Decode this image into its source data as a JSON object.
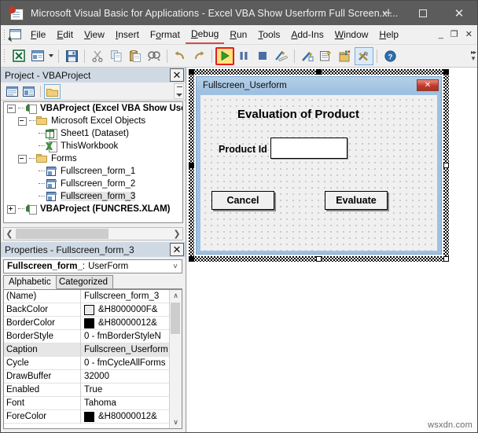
{
  "window": {
    "title": "Microsoft Visual Basic for Applications - Excel VBA Show Userform Full Screen.xl...",
    "icon": "vba-document-icon",
    "minimize_label": "–",
    "maximize_label": "□",
    "close_label": "✕"
  },
  "menubar": {
    "control_icon": "vba-control-icon",
    "items": [
      {
        "label": "File",
        "accel": "F",
        "active": false
      },
      {
        "label": "Edit",
        "accel": "E",
        "active": false
      },
      {
        "label": "View",
        "accel": "V",
        "active": false
      },
      {
        "label": "Insert",
        "accel": "I",
        "active": false
      },
      {
        "label": "Format",
        "accel": "o",
        "active": false
      },
      {
        "label": "Debug",
        "accel": "D",
        "active": true
      },
      {
        "label": "Run",
        "accel": "R",
        "active": false
      },
      {
        "label": "Tools",
        "accel": "T",
        "active": false
      },
      {
        "label": "Add-Ins",
        "accel": "A",
        "active": false
      },
      {
        "label": "Window",
        "accel": "W",
        "active": false
      },
      {
        "label": "Help",
        "accel": "H",
        "active": false
      }
    ],
    "doc_controls": {
      "minimize": "_",
      "restore": "❐",
      "close": "✕"
    }
  },
  "toolbar": {
    "buttons": [
      {
        "name": "view-excel-icon",
        "title": "View Microsoft Excel",
        "state": "normal"
      },
      {
        "name": "insert-userform-icon",
        "title": "Insert UserForm",
        "state": "normal"
      },
      {
        "name": "insert-dropdown-caret-icon",
        "title": "Insert dropdown",
        "state": "caret"
      },
      {
        "name": "save-icon",
        "title": "Save",
        "state": "normal"
      },
      {
        "name": "cut-icon",
        "title": "Cut",
        "state": "normal"
      },
      {
        "name": "copy-icon",
        "title": "Copy",
        "state": "normal"
      },
      {
        "name": "paste-icon",
        "title": "Paste",
        "state": "normal"
      },
      {
        "name": "find-icon",
        "title": "Find",
        "state": "normal"
      },
      {
        "name": "undo-icon",
        "title": "Undo",
        "state": "normal"
      },
      {
        "name": "redo-icon",
        "title": "Redo",
        "state": "normal"
      },
      {
        "name": "run-sub-userform-icon",
        "title": "Run Sub/UserForm",
        "state": "highlighted"
      },
      {
        "name": "break-icon",
        "title": "Break",
        "state": "normal"
      },
      {
        "name": "reset-icon",
        "title": "Reset",
        "state": "normal"
      },
      {
        "name": "design-mode-icon",
        "title": "Design Mode",
        "state": "normal"
      },
      {
        "name": "project-explorer-icon",
        "title": "Project Explorer",
        "state": "normal"
      },
      {
        "name": "properties-window-icon",
        "title": "Properties Window",
        "state": "normal"
      },
      {
        "name": "object-browser-icon",
        "title": "Object Browser",
        "state": "normal"
      },
      {
        "name": "toolbox-icon",
        "title": "Toolbox",
        "state": "selected"
      },
      {
        "name": "help-icon",
        "title": "Help",
        "state": "normal"
      }
    ],
    "highlight_color": "#e02020",
    "overflow_icon": "toolbar-overflow-icon"
  },
  "project_explorer": {
    "title": "Project - VBAProject",
    "close_icon": "close-icon",
    "tools": [
      {
        "name": "view-code-icon",
        "title": "View Code"
      },
      {
        "name": "view-object-icon",
        "title": "View Object"
      },
      {
        "name": "toggle-folders-icon",
        "title": "Toggle Folders",
        "selected": true
      }
    ],
    "tree": [
      {
        "label": "VBAProject (Excel VBA Show Use",
        "indent": 0,
        "node": "minus",
        "icon": "project-icon",
        "bold": true,
        "selected": false
      },
      {
        "label": "Microsoft Excel Objects",
        "indent": 1,
        "node": "minus",
        "icon": "folder-icon",
        "bold": false,
        "selected": false
      },
      {
        "label": "Sheet1 (Dataset)",
        "indent": 2,
        "node": "none",
        "icon": "worksheet-icon",
        "bold": false,
        "selected": false
      },
      {
        "label": "ThisWorkbook",
        "indent": 2,
        "node": "none",
        "icon": "workbook-icon",
        "bold": false,
        "selected": false
      },
      {
        "label": "Forms",
        "indent": 1,
        "node": "minus",
        "icon": "folder-icon",
        "bold": false,
        "selected": false
      },
      {
        "label": "Fullscreen_form_1",
        "indent": 2,
        "node": "none",
        "icon": "userform-icon",
        "bold": false,
        "selected": false
      },
      {
        "label": "Fullscreen_form_2",
        "indent": 2,
        "node": "none",
        "icon": "userform-icon",
        "bold": false,
        "selected": false
      },
      {
        "label": "Fullscreen_form_3",
        "indent": 2,
        "node": "none",
        "icon": "userform-icon",
        "bold": false,
        "selected": true
      },
      {
        "label": "VBAProject (FUNCRES.XLAM)",
        "indent": 0,
        "node": "plus",
        "icon": "project-icon",
        "bold": true,
        "selected": false
      }
    ],
    "hscroll": {
      "left_icon": "❮",
      "right_icon": "❯"
    }
  },
  "properties": {
    "title": "Properties - Fullscreen_form_3",
    "close_icon": "close-icon",
    "object_name": "Fullscreen_form_",
    "object_type": "UserForm",
    "dropdown_icon": "chevron-down-icon",
    "tabs": [
      {
        "label": "Alphabetic",
        "selected": true
      },
      {
        "label": "Categorized",
        "selected": false
      }
    ],
    "rows": [
      {
        "key": "(Name)",
        "value": "Fullscreen_form_3",
        "swatch": null,
        "highlighted": false
      },
      {
        "key": "BackColor",
        "value": "&H8000000F&",
        "swatch": "#ececec",
        "highlighted": false
      },
      {
        "key": "BorderColor",
        "value": "&H80000012&",
        "swatch": "#000000",
        "highlighted": false
      },
      {
        "key": "BorderStyle",
        "value": "0 - fmBorderStyleN",
        "swatch": null,
        "highlighted": false
      },
      {
        "key": "Caption",
        "value": "Fullscreen_Userform",
        "swatch": null,
        "highlighted": true
      },
      {
        "key": "Cycle",
        "value": "0 - fmCycleAllForms",
        "swatch": null,
        "highlighted": false
      },
      {
        "key": "DrawBuffer",
        "value": "32000",
        "swatch": null,
        "highlighted": false
      },
      {
        "key": "Enabled",
        "value": "True",
        "swatch": null,
        "highlighted": false
      },
      {
        "key": "Font",
        "value": "Tahoma",
        "swatch": null,
        "highlighted": false
      },
      {
        "key": "ForeColor",
        "value": "&H80000012&",
        "swatch": "#000000",
        "highlighted": false
      }
    ],
    "scroll": {
      "up_icon": "∧",
      "down_icon": "∨"
    }
  },
  "designer": {
    "form": {
      "caption": "Fullscreen_Userform",
      "close_label": "✕",
      "title_label": "Evaluation of Product",
      "field_label": "Product Id",
      "textbox_value": "",
      "buttons": [
        {
          "label": "Cancel",
          "name": "cancel-button"
        },
        {
          "label": "Evaluate",
          "name": "evaluate-button"
        }
      ]
    }
  },
  "watermark": "wsxdn.com"
}
